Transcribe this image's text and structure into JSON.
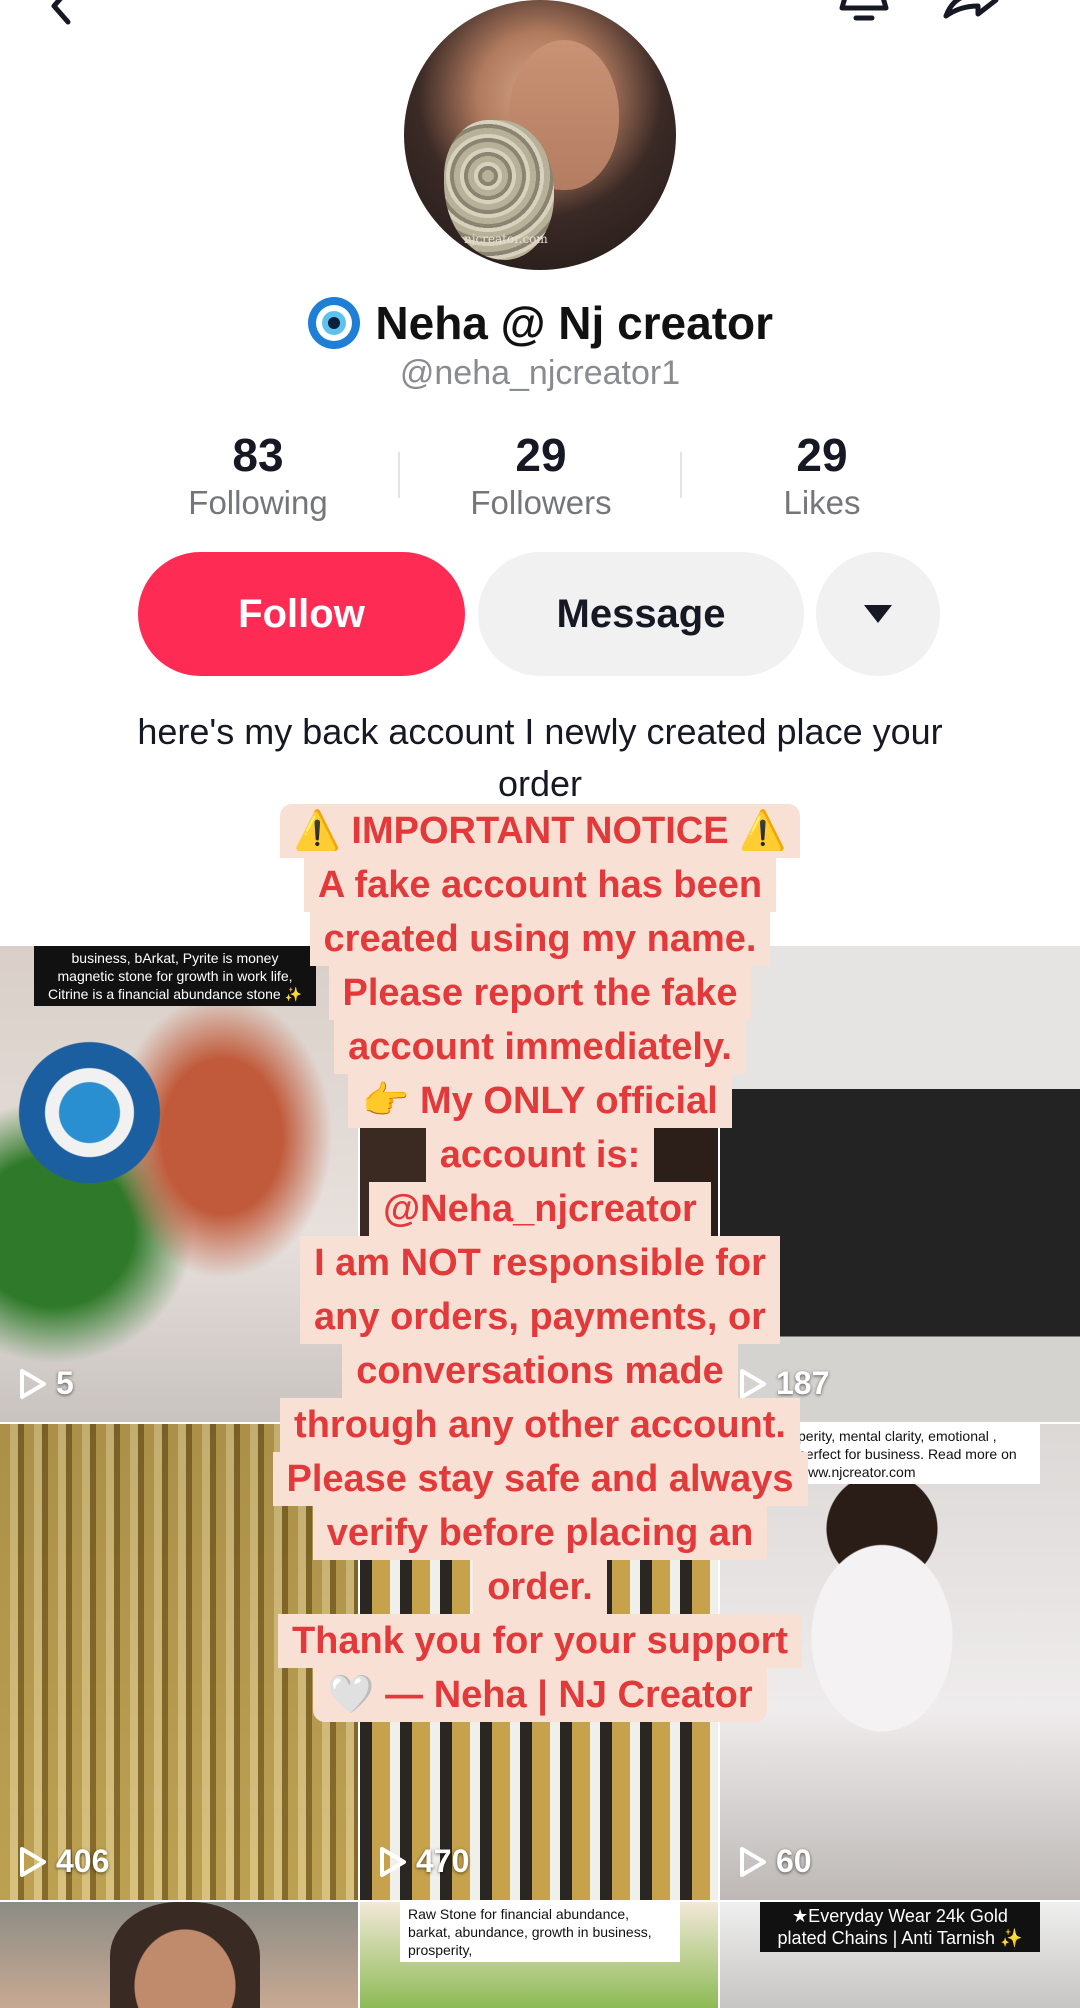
{
  "profile": {
    "display_name": "Neha @ Nj creator",
    "username": "@neha_njcreator1",
    "avatar_watermark": "njcreator.com"
  },
  "stats": [
    {
      "value": "83",
      "label": "Following"
    },
    {
      "value": "29",
      "label": "Followers"
    },
    {
      "value": "29",
      "label": "Likes"
    }
  ],
  "actions": {
    "follow_label": "Follow",
    "message_label": "Message"
  },
  "bio": "here's my back account I newly created place your order",
  "notice": [
    "⚠️ IMPORTANT NOTICE ⚠️",
    "A fake account has been",
    "created using my name.",
    "Please report the fake",
    "account immediately.",
    "👉 My ONLY official",
    "account is:",
    "@Neha_njcreator",
    "I am NOT responsible for",
    "any orders, payments, or",
    "conversations made",
    "through any other account.",
    "Please stay safe and always",
    "verify before placing an",
    "order.",
    "Thank you for your support",
    "🤍 — Neha | NJ Creator"
  ],
  "videos": [
    {
      "views": "5",
      "caption": "business, bArkat, Pyrite is money magnetic stone for growth in work life, Citrine is a financial abundance stone ✨"
    },
    {
      "views": "",
      "caption": ""
    },
    {
      "views": "187",
      "caption": ""
    },
    {
      "views": "406",
      "caption": ""
    },
    {
      "views": "470",
      "caption": ""
    },
    {
      "views": "60",
      "caption": "perity, mental clarity, emotional , perfect for business. Read more on www.njcreator.com"
    },
    {
      "views": "",
      "caption": ""
    },
    {
      "views": "",
      "caption": "Raw Stone for financial abundance, barkat, abundance, growth in business, prosperity,"
    },
    {
      "views": "",
      "caption": "★Everyday Wear 24k Gold plated Chains | Anti Tarnish ✨"
    }
  ],
  "colors": {
    "follow": "#fe2c55",
    "notice_text": "#e2393a",
    "notice_bg": "#f9e0d5"
  }
}
